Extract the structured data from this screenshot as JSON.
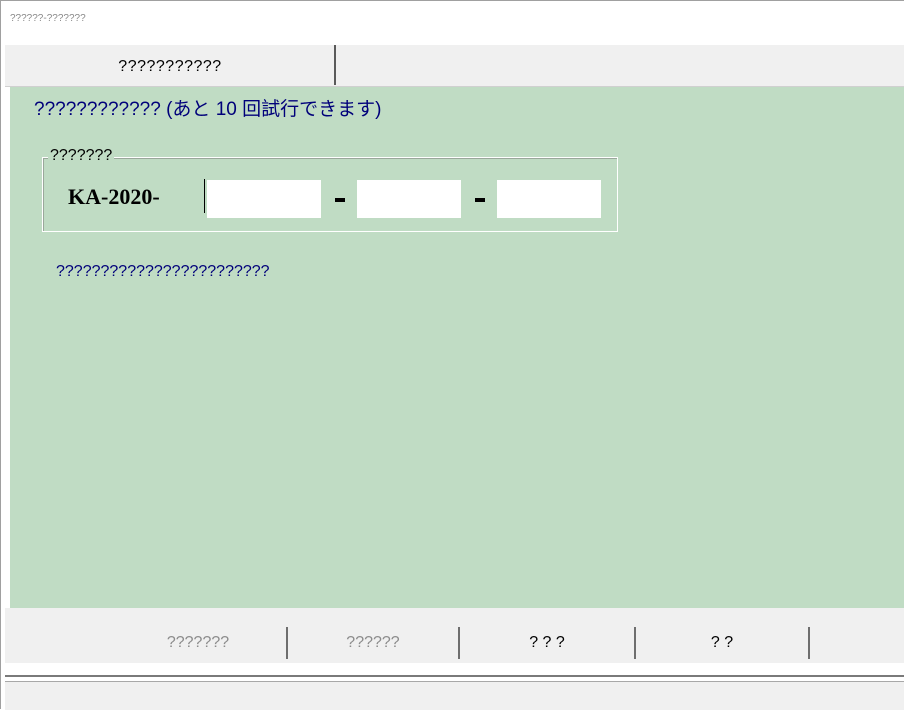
{
  "window": {
    "title": "??????-???????"
  },
  "tabs": [
    {
      "label": "???????????"
    }
  ],
  "main": {
    "info_text": "???????????? (あと 10 回試行できます)",
    "group": {
      "legend": "???????",
      "prefix": "KA-2020-",
      "fields": [
        {
          "value": "",
          "placeholder": ""
        },
        {
          "value": "",
          "placeholder": ""
        },
        {
          "value": "",
          "placeholder": ""
        }
      ]
    },
    "message": "????????????????????????"
  },
  "buttons": [
    {
      "label": "???????",
      "enabled": false
    },
    {
      "label": "??????",
      "enabled": false
    },
    {
      "label": "? ? ?",
      "enabled": true
    },
    {
      "label": "? ?",
      "enabled": true
    }
  ],
  "colors": {
    "content_bg": "#c0dcc4",
    "info_text": "#00007a",
    "disabled_text": "#8c8c8c"
  }
}
